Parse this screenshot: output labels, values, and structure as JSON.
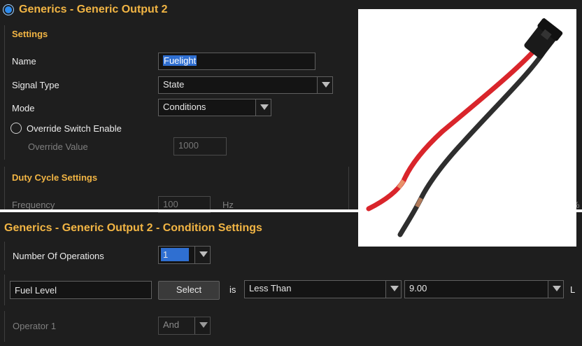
{
  "panel1": {
    "title": "Generics - Generic Output 2",
    "settings_header": "Settings",
    "name_label": "Name",
    "name_value": "Fuelight",
    "signal_type_label": "Signal Type",
    "signal_type_value": "State",
    "mode_label": "Mode",
    "mode_value": "Conditions",
    "override_switch_label": "Override Switch Enable",
    "override_value_label": "Override Value",
    "override_value": "1000",
    "duty_cycle_header": "Duty Cycle Settings",
    "frequency_label": "Frequency",
    "frequency_value": "100",
    "frequency_unit": "Hz",
    "edge_label": "%"
  },
  "panel2": {
    "title": "Generics - Generic Output 2 - Condition Settings",
    "num_ops_label": "Number Of Operations",
    "num_ops_value": "1",
    "condition_source": "Fuel Level",
    "select_button": "Select",
    "is_label": "is",
    "comparator_value": "Less Than",
    "threshold_value": "9.00",
    "unit_cut": "L",
    "operator_label": "Operator 1",
    "operator_value": "And"
  },
  "icons": {
    "title_radio": "radio-selected-icon",
    "override_radio": "radio-empty-icon",
    "dropdown": "chevron-down-icon"
  },
  "colors": {
    "background": "#1e1e1e",
    "heading": "#f2b544",
    "selection": "#2f6fd1"
  }
}
